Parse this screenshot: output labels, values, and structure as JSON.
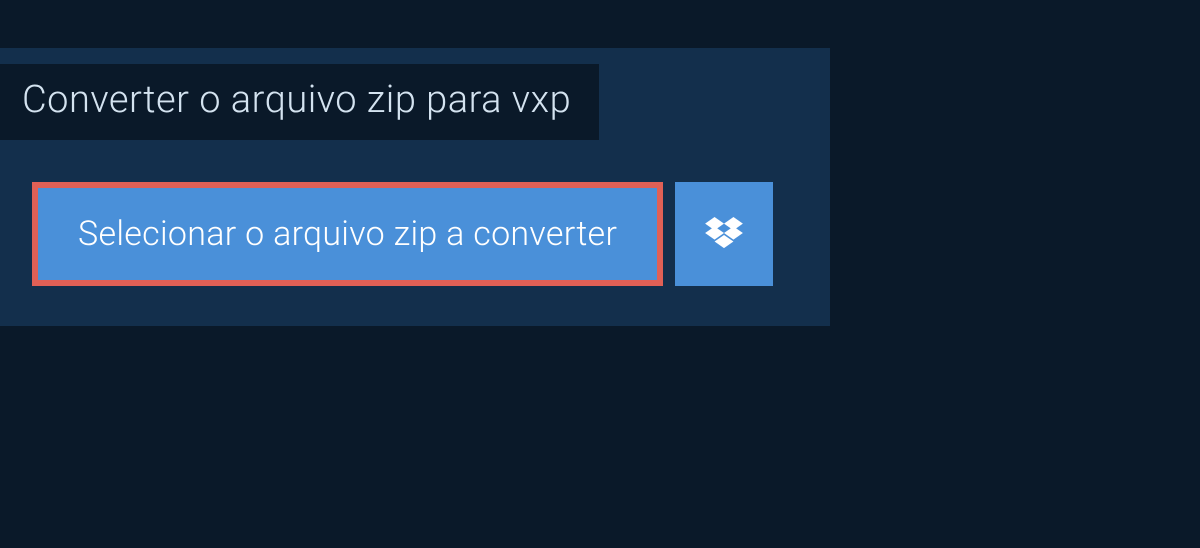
{
  "header": {
    "title": "Converter o arquivo zip para vxp"
  },
  "buttons": {
    "select_file_label": "Selecionar o arquivo zip a converter"
  },
  "colors": {
    "background": "#0a1929",
    "panel": "#132f4c",
    "button_primary": "#4a90d9",
    "button_highlight_border": "#e06056",
    "text_light": "#d4e3f0",
    "text_white": "#ffffff"
  }
}
